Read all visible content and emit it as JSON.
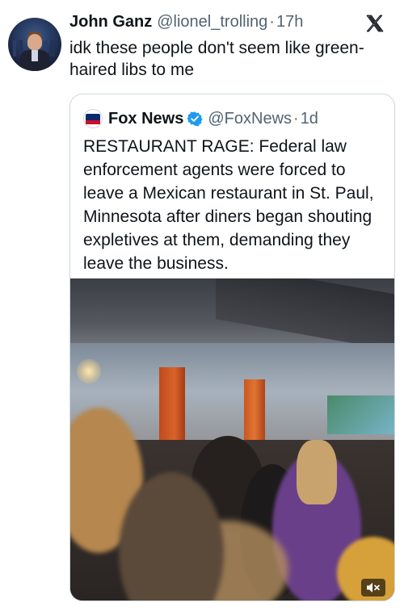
{
  "tweet": {
    "author_name": "John Ganz",
    "handle": "@lionel_trolling",
    "separator": "·",
    "time": "17h",
    "text": "idk these people don't seem like green-haired libs to me"
  },
  "quote": {
    "author_name": "Fox News",
    "handle": "@FoxNews",
    "separator": "·",
    "time": "1d",
    "text": "RESTAURANT RAGE: Federal law enforcement agents were forced to leave a Mexican restaurant in St. Paul, Minnesota after diners began shouting expletives at them, demanding they leave the business."
  },
  "icons": {
    "platform_logo": "x-logo-icon",
    "verified_badge": "verified-badge-icon",
    "mute": "speaker-muted-icon"
  },
  "colors": {
    "text_primary": "#0f1419",
    "text_secondary": "#536471",
    "verified_blue": "#1d9bf0",
    "border": "#cfd9de"
  }
}
